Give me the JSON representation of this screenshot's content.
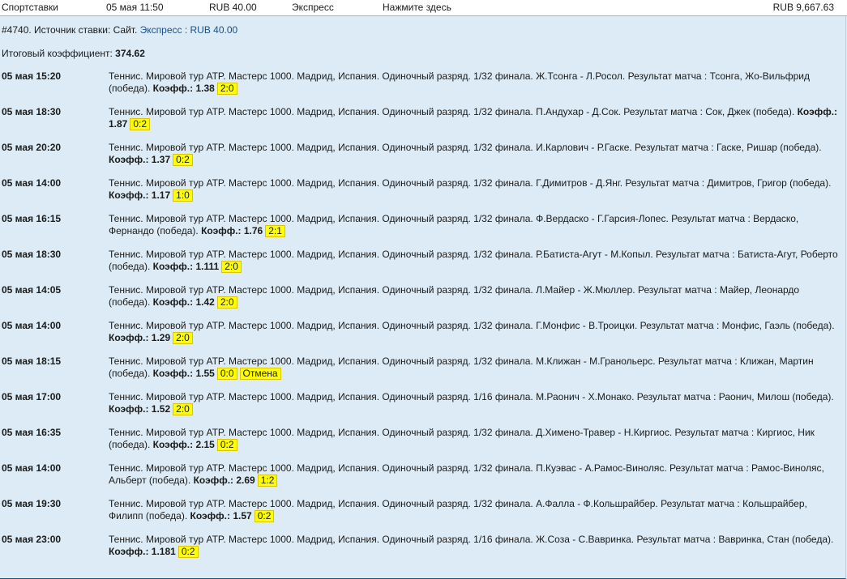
{
  "topbar": {
    "type": "Спортставки",
    "date": "05 мая 11:50",
    "stake": "RUB 40.00",
    "bet_kind": "Экспресс",
    "hint": "Нажмите здесь",
    "balance": "RUB 9,667.63"
  },
  "header": {
    "bet_line": "#4740. Источник ставки: Сайт.",
    "bet_link": "Экспресс : RUB 40.00",
    "total_label": "Итоговый коэффициент:",
    "total_value": "374.62"
  },
  "coef_label": "Коэфф.:",
  "bets": [
    {
      "time": "05 мая 15:20",
      "desc": "Теннис. Мировой тур ATP. Мастерс 1000. Мадрид, Испания. Одиночный разряд. 1/32 финала. Ж.Тсонга - Л.Росол. Результат матча : Тсонга, Жо-Вильфрид (победа).",
      "coef": "1.38",
      "score": "2:0",
      "extra": ""
    },
    {
      "time": "05 мая 18:30",
      "desc": "Теннис. Мировой тур ATP. Мастерс 1000. Мадрид, Испания. Одиночный разряд. 1/32 финала. П.Андухар - Д.Сок. Результат матча : Сок, Джек (победа).",
      "coef": "1.87",
      "score": "0:2",
      "extra": ""
    },
    {
      "time": "05 мая 20:20",
      "desc": "Теннис. Мировой тур ATP. Мастерс 1000. Мадрид, Испания. Одиночный разряд. 1/32 финала. И.Карлович - Р.Гаске. Результат матча : Гаске, Ришар (победа).",
      "coef": "1.37",
      "score": "0:2",
      "extra": ""
    },
    {
      "time": "05 мая 14:00",
      "desc": "Теннис. Мировой тур ATP. Мастерс 1000. Мадрид, Испания. Одиночный разряд. 1/32 финала. Г.Димитров - Д.Янг. Результат матча : Димитров, Григор (победа).",
      "coef": "1.17",
      "score": "1:0",
      "extra": ""
    },
    {
      "time": "05 мая 16:15",
      "desc": "Теннис. Мировой тур ATP. Мастерс 1000. Мадрид, Испания. Одиночный разряд. 1/32 финала. Ф.Вердаско - Г.Гарсия-Лопес. Результат матча : Вердаско, Фернандо (победа).",
      "coef": "1.76",
      "score": "2:1",
      "extra": ""
    },
    {
      "time": "05 мая 18:30",
      "desc": "Теннис. Мировой тур ATP. Мастерс 1000. Мадрид, Испания. Одиночный разряд. 1/32 финала. Р.Батиста-Агут - М.Копыл. Результат матча : Батиста-Агут, Роберто (победа).",
      "coef": "1.111",
      "score": "2:0",
      "extra": ""
    },
    {
      "time": "05 мая 14:05",
      "desc": "Теннис. Мировой тур ATP. Мастерс 1000. Мадрид, Испания. Одиночный разряд. 1/32 финала. Л.Майер - Ж.Мюллер. Результат матча : Майер, Леонардо (победа).",
      "coef": "1.42",
      "score": "2:0",
      "extra": ""
    },
    {
      "time": "05 мая 14:00",
      "desc": "Теннис. Мировой тур ATP. Мастерс 1000. Мадрид, Испания. Одиночный разряд. 1/32 финала. Г.Монфис - В.Троицки. Результат матча : Монфис, Гаэль (победа).",
      "coef": "1.29",
      "score": "2:0",
      "extra": ""
    },
    {
      "time": "05 мая 18:15",
      "desc": "Теннис. Мировой тур ATP. Мастерс 1000. Мадрид, Испания. Одиночный разряд. 1/32 финала. М.Клижан - М.Гранольерс. Результат матча : Клижан, Мартин (победа).",
      "coef": "1.55",
      "score": "0:0",
      "extra": "Отмена"
    },
    {
      "time": "05 мая 17:00",
      "desc": "Теннис. Мировой тур ATP. Мастерс 1000. Мадрид, Испания. Одиночный разряд. 1/16 финала. М.Раонич - Х.Монако. Результат матча : Раонич, Милош (победа).",
      "coef": "1.52",
      "score": "2:0",
      "extra": ""
    },
    {
      "time": "05 мая 16:35",
      "desc": "Теннис. Мировой тур ATP. Мастерс 1000. Мадрид, Испания. Одиночный разряд. 1/32 финала. Д.Химено-Травер - Н.Киргиос. Результат матча : Киргиос, Ник (победа).",
      "coef": "2.15",
      "score": "0:2",
      "extra": ""
    },
    {
      "time": "05 мая 14:00",
      "desc": "Теннис. Мировой тур ATP. Мастерс 1000. Мадрид, Испания. Одиночный разряд. 1/32 финала. П.Куэвас - А.Рамос-Виноляс. Результат матча : Рамос-Виноляс, Альберт (победа).",
      "coef": "2.69",
      "score": "1:2",
      "extra": ""
    },
    {
      "time": "05 мая 19:30",
      "desc": "Теннис. Мировой тур ATP. Мастерс 1000. Мадрид, Испания. Одиночный разряд. 1/32 финала. А.Фалла - Ф.Кольшрайбер. Результат матча : Кольшрайбер, Филипп (победа).",
      "coef": "1.57",
      "score": "0:2",
      "extra": ""
    },
    {
      "time": "05 мая 23:00",
      "desc": "Теннис. Мировой тур ATP. Мастерс 1000. Мадрид, Испания. Одиночный разряд. 1/16 финала. Ж.Соза - С.Вавринка. Результат матча : Вавринка, Стан (победа).",
      "coef": "1.181",
      "score": "0:2",
      "extra": ""
    }
  ]
}
